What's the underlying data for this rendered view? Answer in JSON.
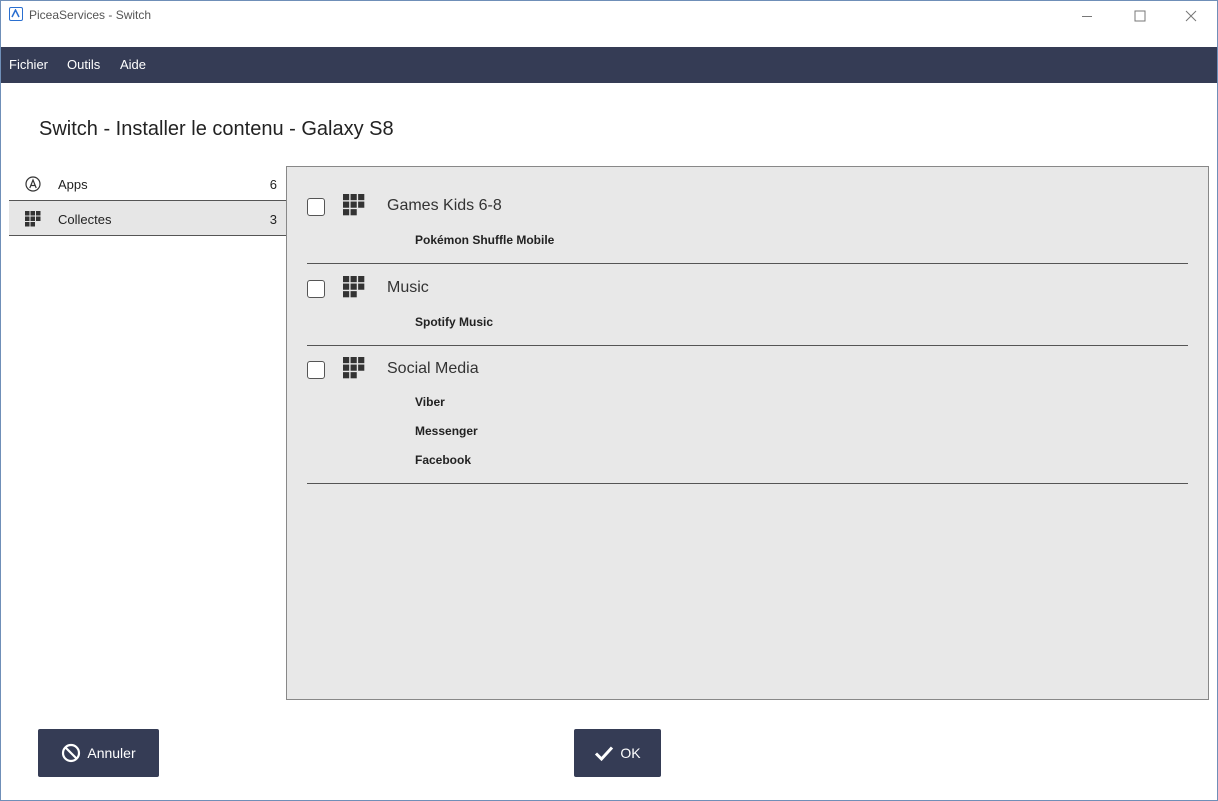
{
  "window": {
    "title": "PiceaServices - Switch",
    "icons": [
      "app-logo-icon",
      "minimize-icon",
      "maximize-icon",
      "close-icon"
    ]
  },
  "menu": {
    "items": [
      {
        "label": "Fichier"
      },
      {
        "label": "Outils"
      },
      {
        "label": "Aide"
      }
    ]
  },
  "page": {
    "title": "Switch - Installer le contenu - Galaxy S8"
  },
  "sidebar": {
    "items": [
      {
        "label": "Apps",
        "count": "6",
        "icon": "apps-circle-icon",
        "selected": false
      },
      {
        "label": "Collectes",
        "count": "3",
        "icon": "grid-icon",
        "selected": true
      }
    ]
  },
  "collections": [
    {
      "title": "Games Kids 6-8",
      "checked": false,
      "apps": [
        "Pokémon Shuffle Mobile"
      ]
    },
    {
      "title": "Music",
      "checked": false,
      "apps": [
        "Spotify Music"
      ]
    },
    {
      "title": "Social Media",
      "checked": false,
      "apps": [
        "Viber",
        "Messenger",
        "Facebook"
      ]
    }
  ],
  "buttons": {
    "cancel_label": "Annuler",
    "ok_label": "OK"
  },
  "colors": {
    "menubar": "#353c55",
    "button": "#353c55",
    "panel": "#e8e8e8",
    "accent": "#2a6fd0"
  }
}
